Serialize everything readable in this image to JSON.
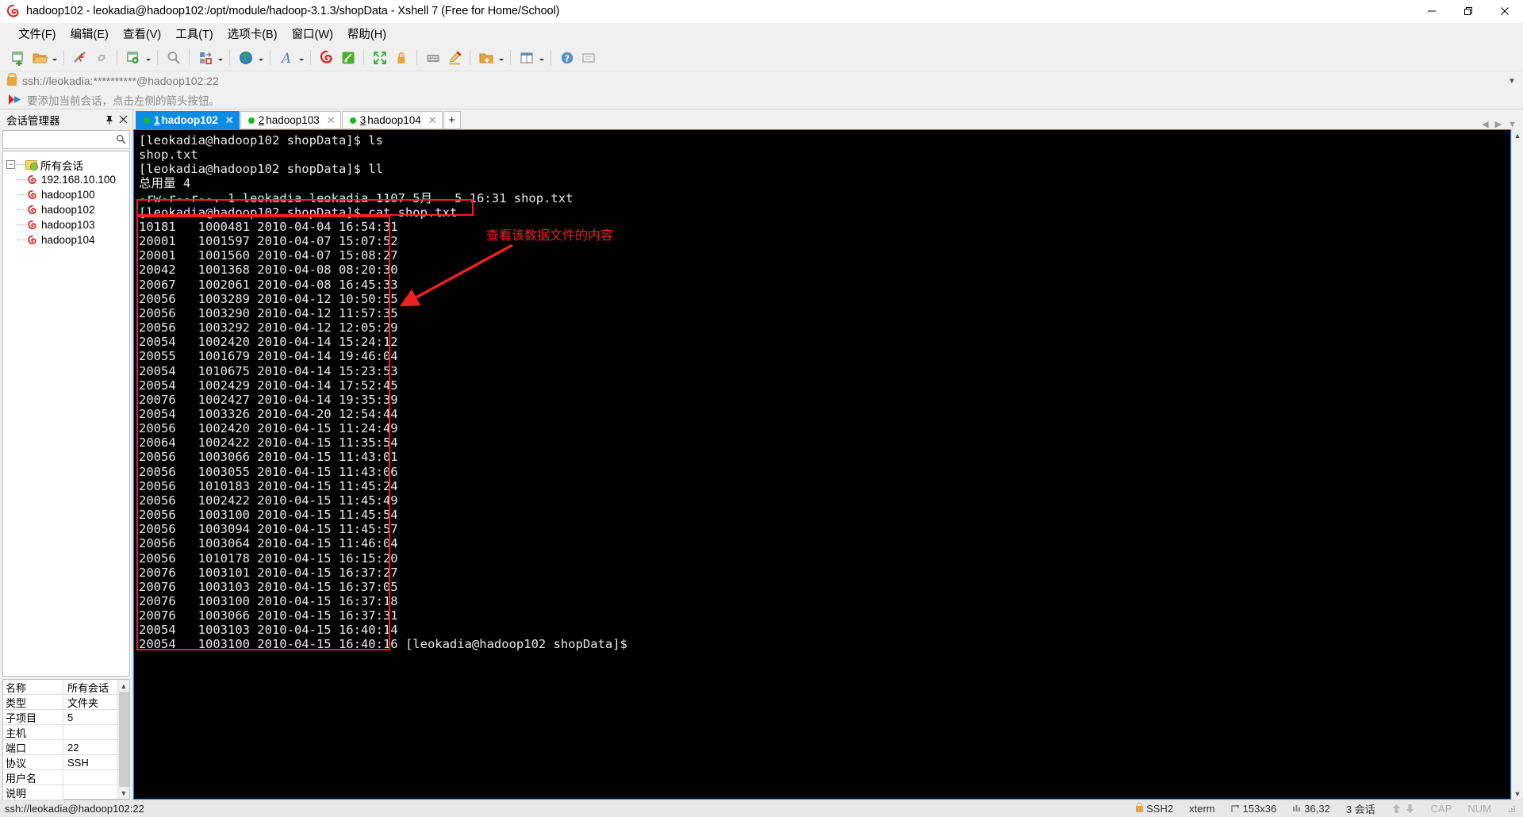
{
  "window": {
    "title": "hadoop102 - leokadia@hadoop102:/opt/module/hadoop-3.1.3/shopData - Xshell 7 (Free for Home/School)",
    "minimize": "—",
    "maximize": "❐",
    "close": "✕"
  },
  "menubar": {
    "items": [
      {
        "label": "文件(F)"
      },
      {
        "label": "编辑(E)"
      },
      {
        "label": "查看(V)"
      },
      {
        "label": "工具(T)"
      },
      {
        "label": "选项卡(B)"
      },
      {
        "label": "窗口(W)"
      },
      {
        "label": "帮助(H)"
      }
    ]
  },
  "toolbar": {
    "icons": [
      "new-session-icon",
      "open-folder-icon",
      "disconnect-icon",
      "link-icon",
      "session-properties-icon",
      "find-icon",
      "transfer-icon",
      "globe-icon",
      "font-icon",
      "xshell-icon",
      "xftp-icon",
      "fullscreen-icon",
      "lock-icon",
      "keyboard-icon",
      "highlight-icon",
      "addfolder-icon",
      "compose-icon"
    ]
  },
  "address": {
    "value": "ssh://leokadia:**********@hadoop102:22",
    "lock": "lock-icon",
    "dropdown": "▼"
  },
  "hint": {
    "text": "要添加当前会话，点击左侧的箭头按钮。"
  },
  "sidebar": {
    "title": "会话管理器",
    "pin": "⎘",
    "close": "✕",
    "search_value": "",
    "tree": {
      "root": {
        "label": "所有会话",
        "expander": "−"
      },
      "children": [
        {
          "label": "192.168.10.100"
        },
        {
          "label": "hadoop100"
        },
        {
          "label": "hadoop102"
        },
        {
          "label": "hadoop103"
        },
        {
          "label": "hadoop104"
        }
      ]
    },
    "properties": [
      {
        "key": "名称",
        "value": "所有会话"
      },
      {
        "key": "类型",
        "value": "文件夹"
      },
      {
        "key": "子项目",
        "value": "5"
      },
      {
        "key": "主机",
        "value": ""
      },
      {
        "key": "端口",
        "value": "22"
      },
      {
        "key": "协议",
        "value": "SSH"
      },
      {
        "key": "用户名",
        "value": ""
      },
      {
        "key": "说明",
        "value": ""
      }
    ]
  },
  "tabs": {
    "items": [
      {
        "num": "1",
        "label": "hadoop102",
        "active": true,
        "close": "✕",
        "dot": "connected"
      },
      {
        "num": "2",
        "label": "hadoop103",
        "active": false,
        "close": "✕",
        "dot": "connected"
      },
      {
        "num": "3",
        "label": "hadoop104",
        "active": false,
        "close": "✕",
        "dot": "connected"
      }
    ],
    "add_label": "+",
    "nav_left": "◀",
    "nav_right": "▶",
    "nav_menu": "▼"
  },
  "terminal": {
    "prompt": "[leokadia@hadoop102 shopData]$",
    "lines": [
      "[leokadia@hadoop102 shopData]$ ls",
      "shop.txt",
      "[leokadia@hadoop102 shopData]$ ll",
      "总用量 4",
      "-rw-r--r--. 1 leokadia leokadia 1107 5月   5 16:31 shop.txt",
      "[leokadia@hadoop102 shopData]$ cat shop.txt",
      "10181   1000481 2010-04-04 16:54:31",
      "20001   1001597 2010-04-07 15:07:52",
      "20001   1001560 2010-04-07 15:08:27",
      "20042   1001368 2010-04-08 08:20:30",
      "20067   1002061 2010-04-08 16:45:33",
      "20056   1003289 2010-04-12 10:50:55",
      "20056   1003290 2010-04-12 11:57:35",
      "20056   1003292 2010-04-12 12:05:29",
      "20054   1002420 2010-04-14 15:24:12",
      "20055   1001679 2010-04-14 19:46:04",
      "20054   1010675 2010-04-14 15:23:53",
      "20054   1002429 2010-04-14 17:52:45",
      "20076   1002427 2010-04-14 19:35:39",
      "20054   1003326 2010-04-20 12:54:44",
      "20056   1002420 2010-04-15 11:24:49",
      "20064   1002422 2010-04-15 11:35:54",
      "20056   1003066 2010-04-15 11:43:01",
      "20056   1003055 2010-04-15 11:43:06",
      "20056   1010183 2010-04-15 11:45:24",
      "20056   1002422 2010-04-15 11:45:49",
      "20056   1003100 2010-04-15 11:45:54",
      "20056   1003094 2010-04-15 11:45:57",
      "20056   1003064 2010-04-15 11:46:04",
      "20056   1010178 2010-04-15 16:15:20",
      "20076   1003101 2010-04-15 16:37:27",
      "20076   1003103 2010-04-15 16:37:05",
      "20076   1003100 2010-04-15 16:37:18",
      "20076   1003066 2010-04-15 16:37:31",
      "20054   1003103 2010-04-15 16:40:14",
      "20054   1003100 2010-04-15 16:40:16 [leokadia@hadoop102 shopData]$"
    ],
    "annotation": "查看该数据文件的内容",
    "highlight_color": "#f02020"
  },
  "statusbar": {
    "connection": "ssh://leokadia@hadoop102:22",
    "protocol": "SSH2",
    "terminal_type": "xterm",
    "size": "153x36",
    "cursor": "36,32",
    "sessions": "3 会话",
    "cap": "CAP",
    "num": "NUM",
    "up_arrow": "↑",
    "down_arrow": "↓"
  }
}
